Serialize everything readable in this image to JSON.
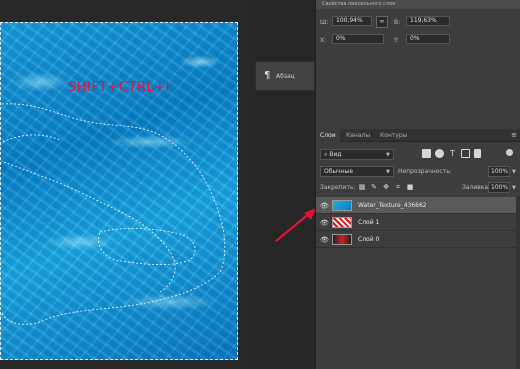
{
  "canvas": {
    "overlay_text": "SHIFT+CTRL+I"
  },
  "paragraph_panel": {
    "symbol": "¶",
    "label": "Абзац"
  },
  "properties": {
    "title": "Свойства пиксельного слоя",
    "w_label": "Ш:",
    "w_value": "100,94%",
    "link_icon": "link-icon",
    "h_label": "В:",
    "h_value": "119,63%",
    "x_label": "X:",
    "x_value": "0%",
    "y_label": "Y:",
    "y_value": "0%"
  },
  "layers_panel": {
    "tabs": [
      "Слои",
      "Каналы",
      "Контуры"
    ],
    "filter_value": "Вид",
    "blend_mode": "Обычные",
    "opacity_label": "Непрозрачность:",
    "opacity_value": "100%",
    "lock_label": "Закрепить:",
    "fill_label": "Заливка:",
    "fill_value": "100%",
    "layers": [
      {
        "name": "Water_Texture_436662",
        "selected": true,
        "thumb_color": "#1da6df"
      },
      {
        "name": "Слой 1",
        "selected": false,
        "thumb_color": "#e6e6e6"
      },
      {
        "name": "Слой 0",
        "selected": false,
        "thumb_color": "#222222"
      }
    ]
  },
  "colors": {
    "accent_arrow": "#e3123a",
    "panel_bg": "#3d3d3d",
    "selected_row": "#5a5a5a"
  }
}
